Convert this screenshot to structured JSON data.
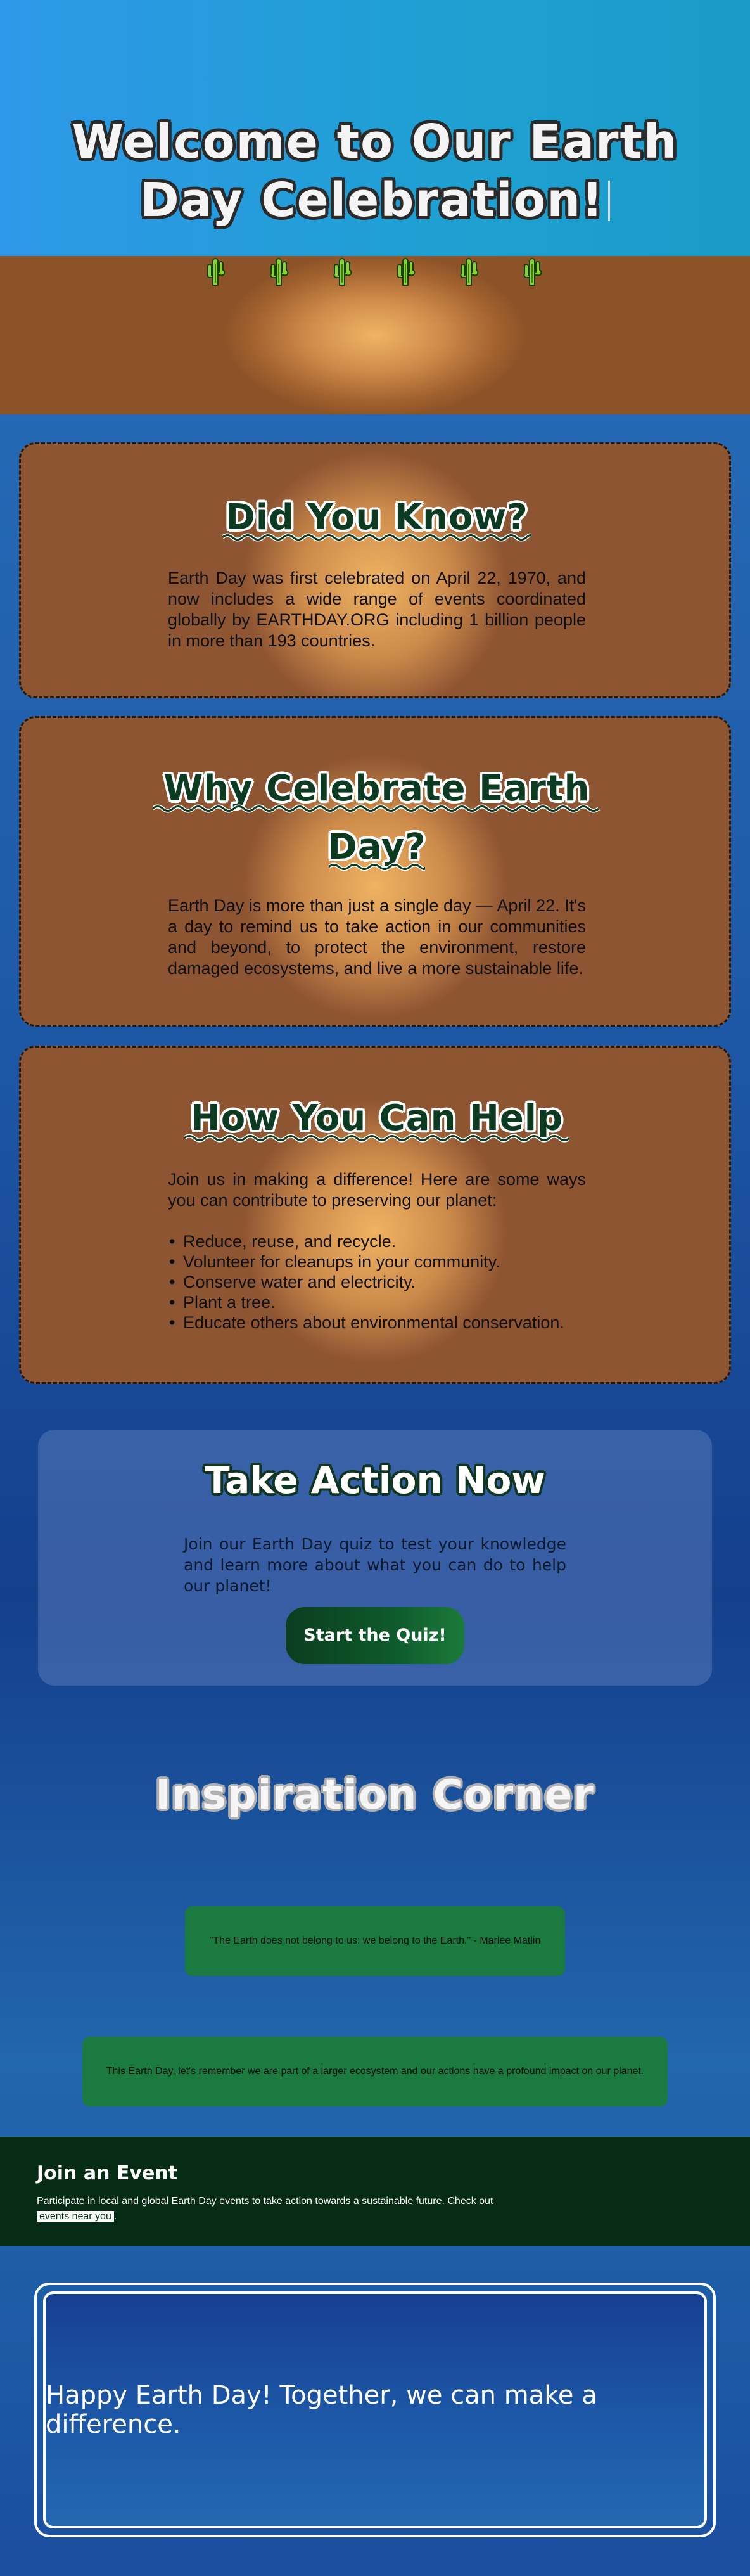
{
  "hero": {
    "title_line1": "Welcome to Our Earth",
    "title_line2": "Day Celebration!"
  },
  "colors": {
    "hero_bg": "#1ea0d2",
    "earth_band": "#cf8a4a",
    "card_title": "#0d3b22",
    "button_green": "#0e5a2c",
    "quote_bg": "#1a7a3f",
    "join_bg": "#062c16",
    "plant": "#7ed321"
  },
  "cards": [
    {
      "title": "Did You Know?",
      "body": "Earth Day was first celebrated on April 22, 1970, and now includes a wide range of events coordinated globally by EARTHDAY.ORG including 1 billion people in more than 193 countries."
    },
    {
      "title_line1": "Why Celebrate Earth",
      "title_line2": "Day?",
      "body": "Earth Day is more than just a single day — April 22. It's a day to remind us to take action in our communities and beyond, to protect the environment, restore damaged ecosystems, and live a more sustainable life."
    },
    {
      "title": "How You Can Help",
      "intro": "Join us in making a difference! Here are some ways you can contribute to preserving our planet:",
      "items": [
        "Reduce, reuse, and recycle.",
        "Volunteer for cleanups in your community.",
        "Conserve water and electricity.",
        "Plant a tree.",
        "Educate others about environmental conservation."
      ]
    }
  ],
  "action": {
    "title": "Take Action Now",
    "text": "Join our Earth Day quiz to test your knowledge and learn more about what you can do to help our planet!",
    "button": "Start the Quiz!"
  },
  "inspiration": {
    "title": "Inspiration Corner",
    "quotes": [
      "\"The Earth does not belong to us: we belong to the Earth.\" - Marlee Matlin",
      "This Earth Day, let's remember we are part of a larger ecosystem and our actions have a profound impact on our planet."
    ]
  },
  "join": {
    "title": "Join an Event",
    "text": "Participate in local and global Earth Day events to take action towards a sustainable future. Check out",
    "link": "events near you",
    "suffix": "."
  },
  "footer": {
    "text": "Happy Earth Day! Together, we can make a difference."
  },
  "icons": [
    "cactus-icon"
  ]
}
